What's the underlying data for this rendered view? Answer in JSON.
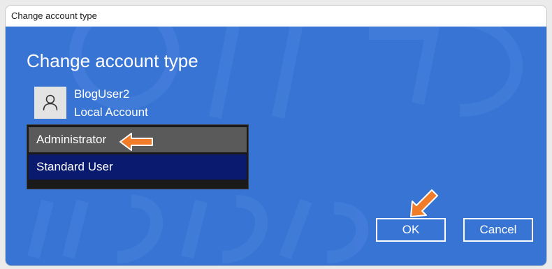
{
  "window": {
    "title": "Change account type"
  },
  "dialog": {
    "heading": "Change account type",
    "account": {
      "name": "BlogUser2",
      "type": "Local Account",
      "avatar_icon": "person-icon"
    },
    "account_types": [
      {
        "label": "Administrator",
        "state": "hover"
      },
      {
        "label": "Standard User",
        "state": "selected"
      }
    ],
    "buttons": {
      "ok": "OK",
      "cancel": "Cancel"
    }
  },
  "annotations": {
    "arrow_color": "#f07c2a"
  },
  "colors": {
    "dialog_bg": "#3874d4",
    "selected_bg": "#0a1a6e",
    "hover_bg": "#5a5a5a"
  }
}
